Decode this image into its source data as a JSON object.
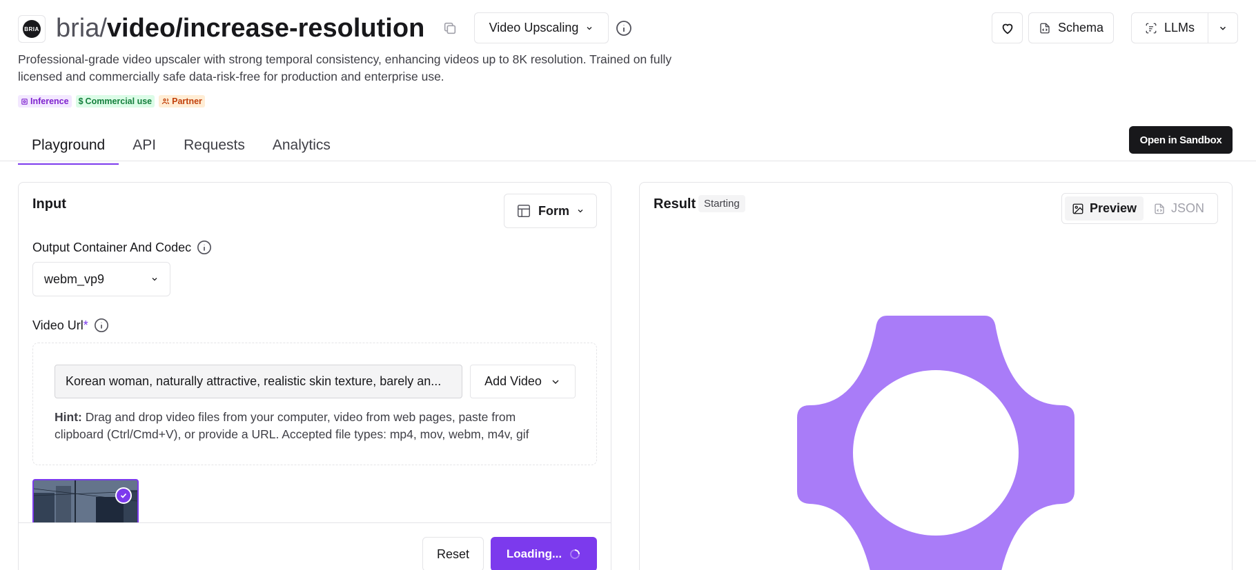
{
  "header": {
    "logo_text": "BRIA",
    "title_owner": "bria/",
    "title_path": "video/increase-resolution",
    "category": "Video Upscaling",
    "schema_label": "Schema",
    "llms_label": "LLMs"
  },
  "description": "Professional-grade video upscaler with strong temporal consistency, enhancing videos up to 8K resolution. Trained on fully licensed and commercially safe data-risk-free for production and enterprise use.",
  "badges": [
    {
      "label": "Inference"
    },
    {
      "label": "Commercial use"
    },
    {
      "label": "Partner"
    }
  ],
  "tabs": [
    {
      "label": "Playground",
      "active": true
    },
    {
      "label": "API"
    },
    {
      "label": "Requests"
    },
    {
      "label": "Analytics"
    }
  ],
  "sandbox_label": "Open in Sandbox",
  "input_panel": {
    "title": "Input",
    "form_label": "Form",
    "codec_label": "Output Container And Codec",
    "codec_value": "webm_vp9",
    "video_url_label": "Video Url",
    "required_mark": "*",
    "video_url_value": "Korean woman, naturally attractive, realistic skin texture, barely an...",
    "add_video_label": "Add Video",
    "hint_prefix": "Hint:",
    "hint_text": " Drag and drop video files from your computer, video from web pages, paste from clipboard (Ctrl/Cmd+V), or provide a URL. Accepted file types: mp4, mov, webm, m4v, gif",
    "reset_label": "Reset",
    "submit_label": "Loading..."
  },
  "result_panel": {
    "title": "Result",
    "status": "Starting",
    "preview_label": "Preview",
    "json_label": "JSON"
  },
  "colors": {
    "accent": "#7c3aed",
    "loader_shape": "#a97cf8"
  }
}
